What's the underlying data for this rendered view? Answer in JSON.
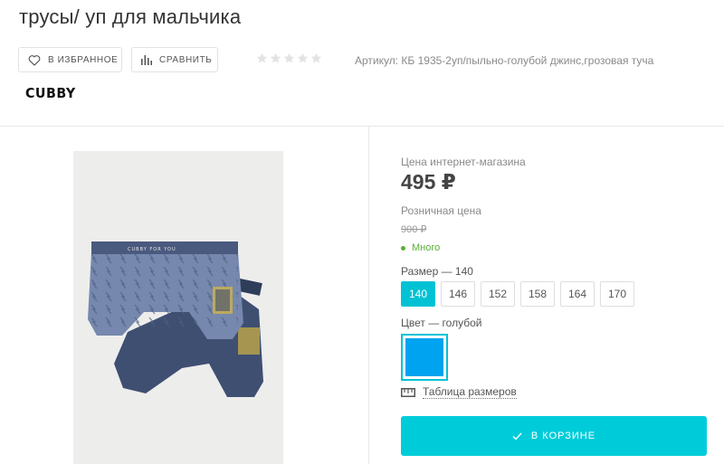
{
  "product": {
    "title": "трусы/ уп для мальчика",
    "sku": "Артикул: КБ 1935-2уп/пыльно-голубой джинс,грозовая туча",
    "brand": "CUBBY",
    "rating": {
      "value": 0,
      "max": 5
    }
  },
  "actions": {
    "favorite_label": "В ИЗБРАННОЕ",
    "compare_label": "СРАВНИТЬ"
  },
  "pricing": {
    "online_label": "Цена интернет-магазина",
    "online_price": "495 ₽",
    "retail_label": "Розничная цена",
    "retail_price": "900 ₽",
    "stock_status": "Много"
  },
  "size": {
    "label": "Размер — 140",
    "selected": "140",
    "options": [
      "140",
      "146",
      "152",
      "158",
      "164",
      "170"
    ]
  },
  "color": {
    "label": "Цвет — голубой",
    "swatch": "#00a3f0"
  },
  "size_table_label": "Таблица размеров",
  "cart_label": "В КОРЗИНЕ",
  "image": {
    "waistband_text": "CUBBY FOR YOU"
  },
  "colors": {
    "accent": "#00c2d4",
    "cart": "#00ccd9",
    "stock": "#58b038"
  }
}
